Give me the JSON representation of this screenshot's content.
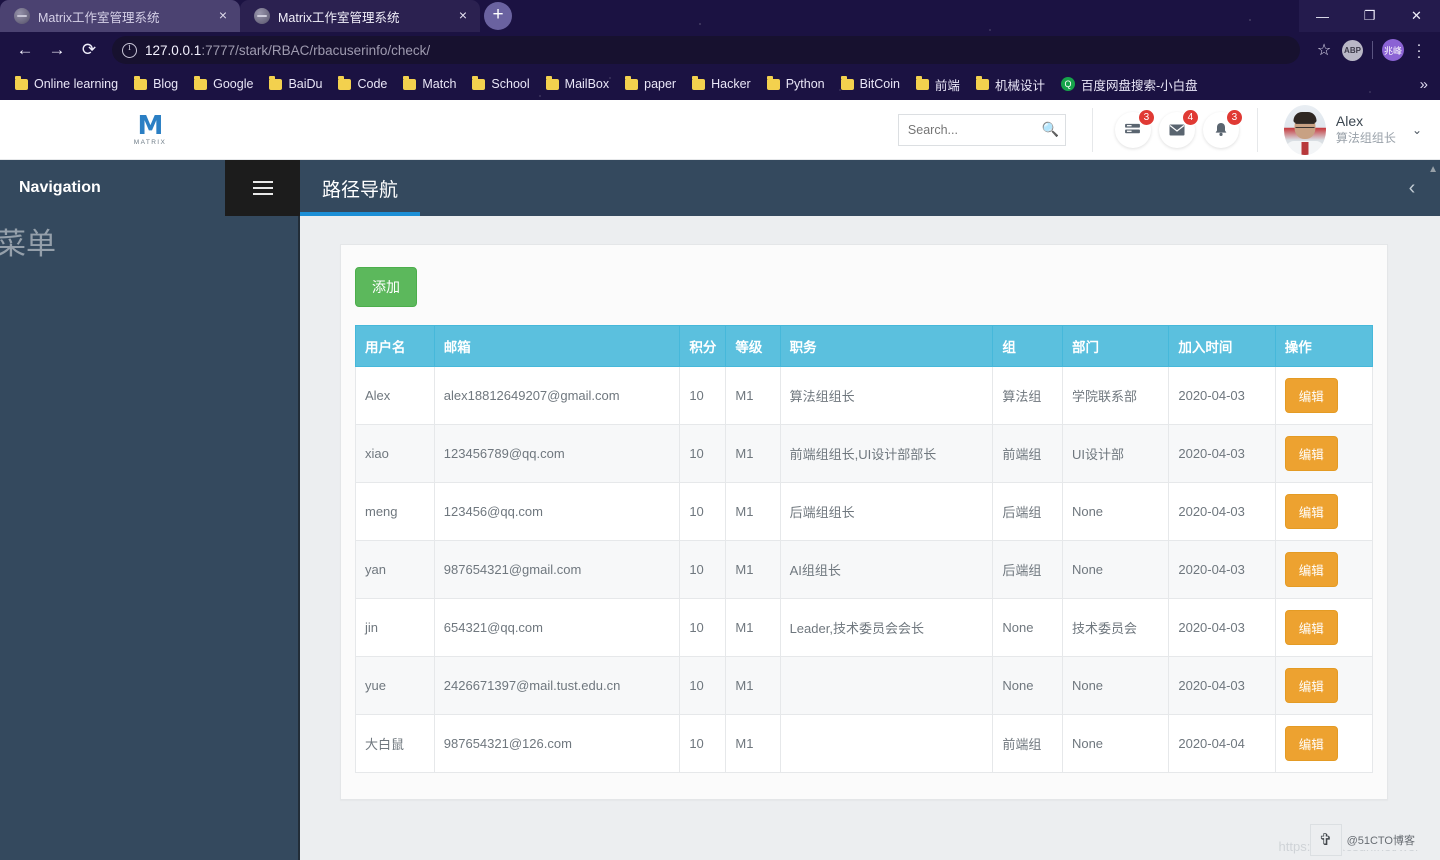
{
  "browser": {
    "tabs": [
      {
        "title": "Matrix工作室管理系统",
        "favicon": "globe-icon",
        "close": "×",
        "active": false
      },
      {
        "title": "Matrix工作室管理系统",
        "favicon": "globe-icon",
        "close": "×",
        "active": true
      }
    ],
    "new_tab_label": "+",
    "window_controls": {
      "minimize": "—",
      "maximize": "❐",
      "close": "✕"
    },
    "toolbar": {
      "back": "←",
      "forward": "→",
      "reload": "⟳",
      "url_host": "127.0.0.1",
      "url_rest": ":7777/stark/RBAC/rbacuserinfo/check/",
      "bookmark_star": "☆",
      "extension_abp": "ABP",
      "profile_initials": "兆峰",
      "menu_dots": "⋮"
    },
    "bookmarks": [
      {
        "label": "Online learning",
        "icon": "folder-icon"
      },
      {
        "label": "Blog",
        "icon": "folder-icon"
      },
      {
        "label": "Google",
        "icon": "folder-icon"
      },
      {
        "label": "BaiDu",
        "icon": "folder-icon"
      },
      {
        "label": "Code",
        "icon": "folder-icon"
      },
      {
        "label": "Match",
        "icon": "folder-icon"
      },
      {
        "label": "School",
        "icon": "folder-icon"
      },
      {
        "label": "MailBox",
        "icon": "folder-icon"
      },
      {
        "label": "paper",
        "icon": "folder-icon"
      },
      {
        "label": "Hacker",
        "icon": "folder-icon"
      },
      {
        "label": "Python",
        "icon": "folder-icon"
      },
      {
        "label": "BitCoin",
        "icon": "folder-icon"
      },
      {
        "label": "前端",
        "icon": "folder-icon"
      },
      {
        "label": "机械设计",
        "icon": "folder-icon"
      },
      {
        "label": "百度网盘搜索-小白盘",
        "icon": "search-badge-icon"
      }
    ],
    "bookmarks_overflow": "»"
  },
  "app": {
    "logo": {
      "mark": "M",
      "sub": "MATRIX"
    },
    "search": {
      "value": "",
      "placeholder": "Search...",
      "icon": "search-icon"
    },
    "nav_icons": [
      {
        "name": "tasks-icon",
        "glyph": "▤",
        "badge": "3"
      },
      {
        "name": "envelope-icon",
        "glyph": "✉",
        "badge": "4"
      },
      {
        "name": "bell-icon",
        "glyph": "🔔",
        "badge": "3"
      }
    ],
    "user": {
      "name": "Alex",
      "role": "算法组组长",
      "caret": "⌄"
    },
    "midbar": {
      "nav_label": "Navigation",
      "burger": "hamburger-icon",
      "breadcrumb_title": "路径导航",
      "collapse": "‹"
    },
    "sidebar": {
      "menu_title": "菜单"
    }
  },
  "main": {
    "add_button": "添加",
    "columns": [
      "用户名",
      "邮箱",
      "积分",
      "等级",
      "职务",
      "组",
      "部门",
      "加入时间",
      "操作"
    ],
    "action_label": "编辑",
    "rows": [
      {
        "user": "Alex",
        "email": "alex18812649207@gmail.com",
        "points": "10",
        "level": "M1",
        "job": "算法组组长",
        "group": "算法组",
        "dept": "学院联系部",
        "joined": "2020-04-03"
      },
      {
        "user": "xiao",
        "email": "123456789@qq.com",
        "points": "10",
        "level": "M1",
        "job": "前端组组长,UI设计部部长",
        "group": "前端组",
        "dept": "UI设计部",
        "joined": "2020-04-03"
      },
      {
        "user": "meng",
        "email": "123456@qq.com",
        "points": "10",
        "level": "M1",
        "job": "后端组组长",
        "group": "后端组",
        "dept": "None",
        "joined": "2020-04-03"
      },
      {
        "user": "yan",
        "email": "987654321@gmail.com",
        "points": "10",
        "level": "M1",
        "job": "AI组组长",
        "group": "后端组",
        "dept": "None",
        "joined": "2020-04-03"
      },
      {
        "user": "jin",
        "email": "654321@qq.com",
        "points": "10",
        "level": "M1",
        "job": "Leader,技术委员会会长",
        "group": "None",
        "dept": "技术委员会",
        "joined": "2020-04-03"
      },
      {
        "user": "yue",
        "email": "2426671397@mail.tust.edu.cn",
        "points": "10",
        "level": "M1",
        "job": "",
        "group": "None",
        "dept": "None",
        "joined": "2020-04-03"
      },
      {
        "user": "大白鼠",
        "email": "987654321@126.com",
        "points": "10",
        "level": "M1",
        "job": "",
        "group": "前端组",
        "dept": "None",
        "joined": "2020-04-04"
      }
    ]
  },
  "watermarks": {
    "url": "https://blog.csdn.net/wei",
    "badge_text": "@51CTO博客",
    "badge_icon": "move-cursor-icon"
  },
  "colors": {
    "header_blue": "#5bc0de",
    "add_green": "#5cb85c",
    "edit_orange": "#eda230",
    "navy": "#34495e",
    "accent_blue": "#1c8fd6",
    "badge_red": "#e03a34"
  }
}
